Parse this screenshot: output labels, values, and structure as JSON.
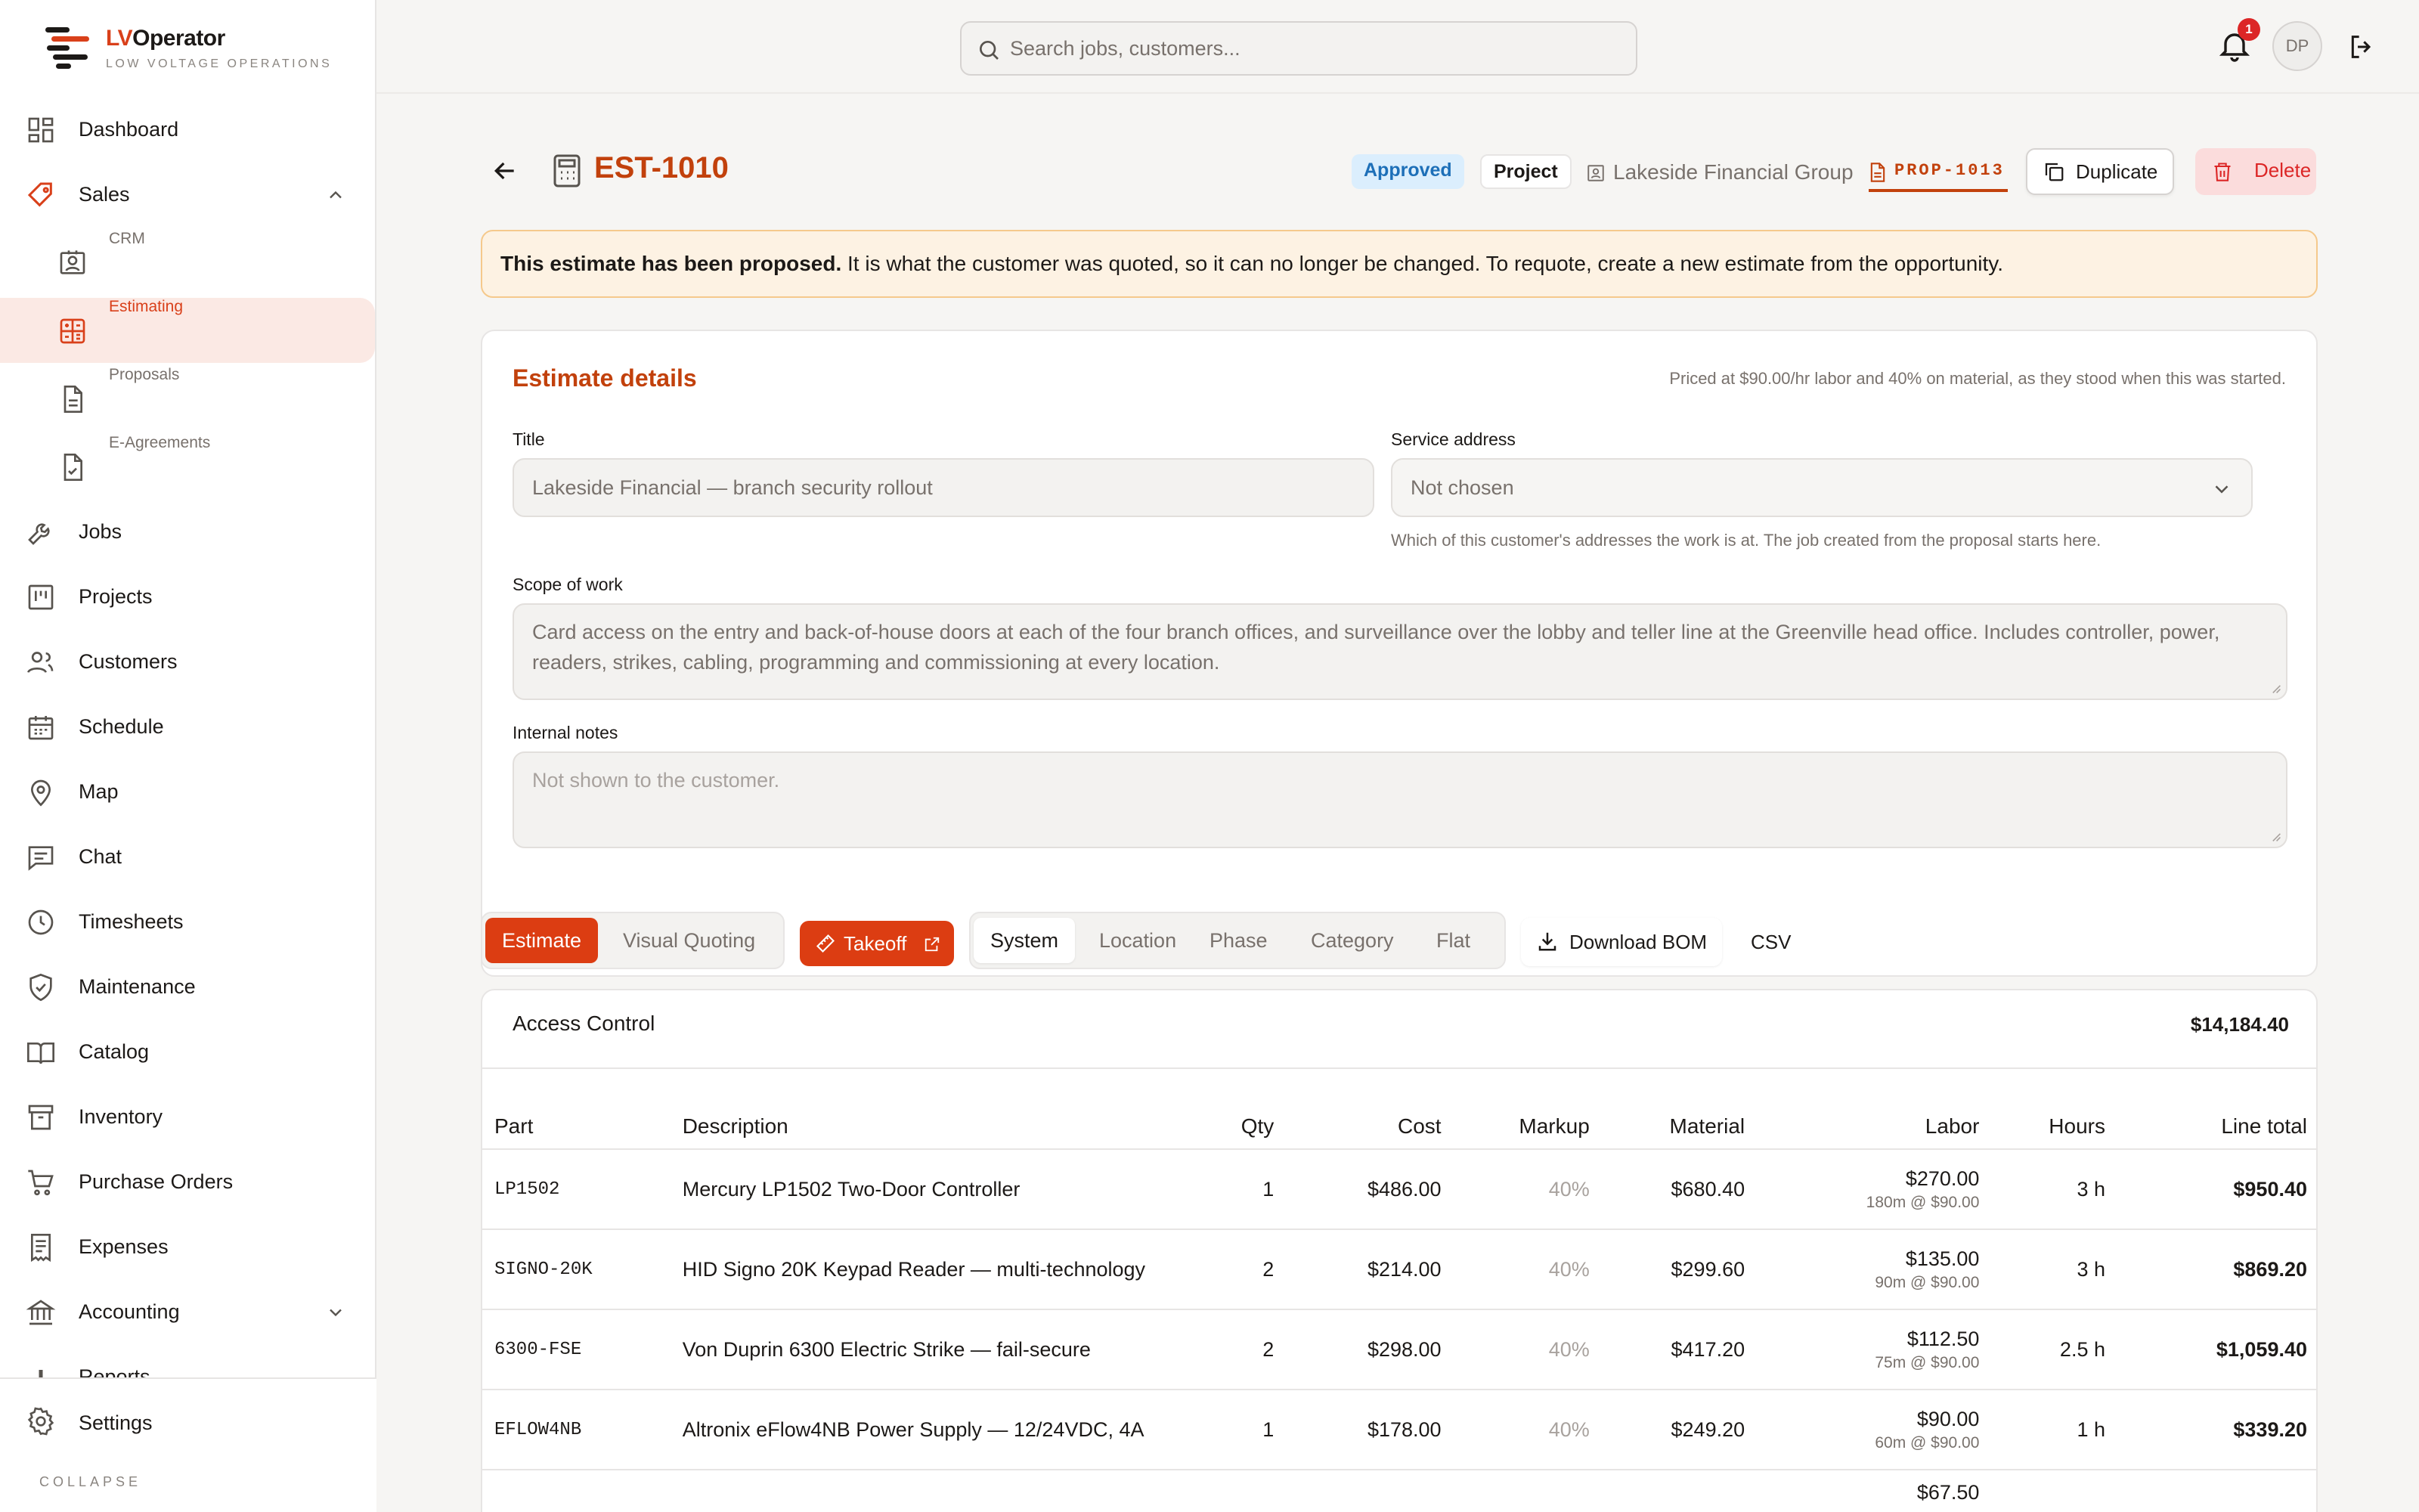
{
  "app": {
    "name_prefix": "LV",
    "name_suffix": "Operator",
    "tagline": "LOW VOLTAGE OPERATIONS"
  },
  "colors": {
    "accent": "#dc3d12",
    "accent_text": "#c2410c",
    "active_bg": "#fbe9e4",
    "approved_bg": "#dbeefd",
    "danger": "#dc2626"
  },
  "sidebar": {
    "items": [
      {
        "label": "Dashboard",
        "icon": "dashboard-icon"
      },
      {
        "label": "Sales",
        "icon": "tag-icon"
      },
      {
        "label": "CRM",
        "icon": "contact-card-icon"
      },
      {
        "label": "Estimating",
        "icon": "calculator-icon"
      },
      {
        "label": "Proposals",
        "icon": "document-icon"
      },
      {
        "label": "E-Agreements",
        "icon": "file-check-icon"
      },
      {
        "label": "Jobs",
        "icon": "wrench-icon"
      },
      {
        "label": "Projects",
        "icon": "kanban-icon"
      },
      {
        "label": "Customers",
        "icon": "users-icon"
      },
      {
        "label": "Schedule",
        "icon": "calendar-icon"
      },
      {
        "label": "Map",
        "icon": "map-pin-icon"
      },
      {
        "label": "Chat",
        "icon": "chat-icon"
      },
      {
        "label": "Timesheets",
        "icon": "clock-icon"
      },
      {
        "label": "Maintenance",
        "icon": "shield-check-icon"
      },
      {
        "label": "Catalog",
        "icon": "book-icon"
      },
      {
        "label": "Inventory",
        "icon": "archive-icon"
      },
      {
        "label": "Purchase Orders",
        "icon": "cart-icon"
      },
      {
        "label": "Expenses",
        "icon": "receipt-icon"
      },
      {
        "label": "Accounting",
        "icon": "bank-icon"
      },
      {
        "label": "Reports",
        "icon": "bar-chart-icon"
      }
    ],
    "settings": "Settings",
    "collapse": "COLLAPSE"
  },
  "topbar": {
    "search_placeholder": "Search jobs, customers...",
    "notif_count": "1",
    "avatar": "DP"
  },
  "header": {
    "estimate_id": "EST-1010",
    "status": "Approved",
    "type": "Project",
    "customer": "Lakeside Financial Group",
    "proposal": "PROP-1013",
    "duplicate": "Duplicate",
    "delete": "Delete"
  },
  "banner": {
    "strong": "This estimate has been proposed.",
    "rest": " It is what the customer was quoted, so it can no longer be changed. To requote, create a new estimate from the opportunity."
  },
  "details": {
    "title": "Estimate details",
    "pricing_note": "Priced at $90.00/hr labor and 40% on material, as they stood when this was started.",
    "title_label": "Title",
    "title_value": "Lakeside Financial — branch security rollout",
    "address_label": "Service address",
    "address_value": "Not chosen",
    "address_hint": "Which of this customer's addresses the work is at. The job created from the proposal starts here.",
    "scope_label": "Scope of work",
    "scope_value": "Card access on the entry and back-of-house doors at each of the four branch offices, and surveillance over the lobby and teller line at the Greenville head office. Includes controller, power, readers, strikes, cabling, programming and commissioning at every location.",
    "notes_label": "Internal notes",
    "notes_placeholder": "Not shown to the customer."
  },
  "toolbar": {
    "mode_tabs": [
      "Estimate",
      "Visual Quoting"
    ],
    "takeoff": "Takeoff",
    "group_tabs": [
      "System",
      "Location",
      "Phase",
      "Category",
      "Flat"
    ],
    "download_bom": "Download BOM",
    "csv": "CSV"
  },
  "system": {
    "name": "Access Control",
    "total": "$14,184.40"
  },
  "table": {
    "columns": [
      "Part",
      "Description",
      "Qty",
      "Cost",
      "Markup",
      "Material",
      "Labor",
      "Hours",
      "Line total"
    ],
    "rows": [
      {
        "part": "LP1502",
        "desc": "Mercury LP1502 Two-Door Controller",
        "qty": "1",
        "cost": "$486.00",
        "markup": "40%",
        "material": "$680.40",
        "labor": "$270.00",
        "labor_sub": "180m @ $90.00",
        "hours": "3 h",
        "total": "$950.40"
      },
      {
        "part": "SIGNO-20K",
        "desc": "HID Signo 20K Keypad Reader — multi-technology",
        "qty": "2",
        "cost": "$214.00",
        "markup": "40%",
        "material": "$299.60",
        "labor": "$135.00",
        "labor_sub": "90m @ $90.00",
        "hours": "3 h",
        "total": "$869.20"
      },
      {
        "part": "6300-FSE",
        "desc": "Von Duprin 6300 Electric Strike — fail-secure",
        "qty": "2",
        "cost": "$298.00",
        "markup": "40%",
        "material": "$417.20",
        "labor": "$112.50",
        "labor_sub": "75m @ $90.00",
        "hours": "2.5 h",
        "total": "$1,059.40"
      },
      {
        "part": "EFLOW4NB",
        "desc": "Altronix eFlow4NB Power Supply — 12/24VDC, 4A",
        "qty": "1",
        "cost": "$178.00",
        "markup": "40%",
        "material": "$249.20",
        "labor": "$90.00",
        "labor_sub": "60m @ $90.00",
        "hours": "1 h",
        "total": "$339.20"
      },
      {
        "part": "",
        "desc": "",
        "qty": "",
        "cost": "",
        "markup": "",
        "material": "",
        "labor": "$67.50",
        "labor_sub": "",
        "hours": "",
        "total": ""
      }
    ]
  }
}
